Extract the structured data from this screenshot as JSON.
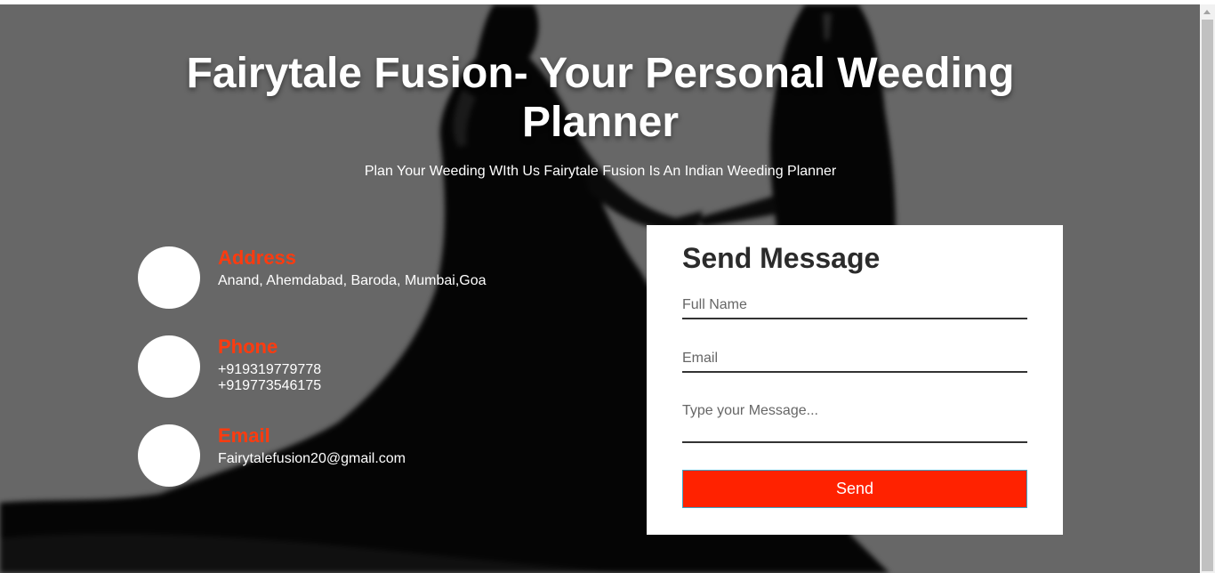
{
  "header": {
    "title": "Fairytale Fusion- Your Personal Weeding Planner",
    "subtitle": "Plan Your Weeding WIth Us Fairytale Fusion Is An Indian Weeding Planner"
  },
  "contact": {
    "address": {
      "label": "Address",
      "value": "Anand, Ahemdabad, Baroda, Mumbai,Goa",
      "icon": "map-marker-icon"
    },
    "phone": {
      "label": "Phone",
      "values": [
        "+919319779778",
        "+919773546175"
      ],
      "icon": "phone-icon"
    },
    "email": {
      "label": "Email",
      "value": "Fairytalefusion20@gmail.com",
      "icon": "envelope-icon"
    }
  },
  "form": {
    "title": "Send Message",
    "name_placeholder": "Full Name",
    "email_placeholder": "Email",
    "message_placeholder": "Type your Message...",
    "send_label": "Send"
  },
  "colors": {
    "accent": "#ff3b0f",
    "button": "#ff2200",
    "background_overlay": "#676767"
  }
}
